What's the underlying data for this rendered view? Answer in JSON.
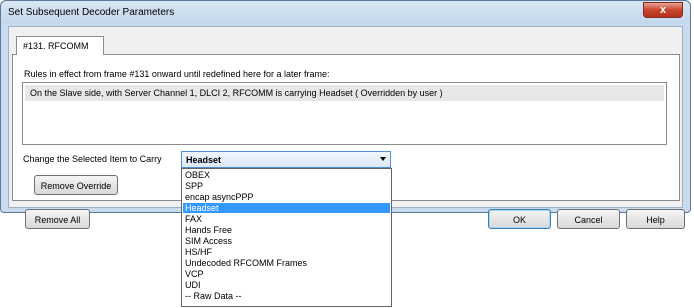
{
  "dialog": {
    "title": "Set Subsequent Decoder Parameters",
    "close_glyph": "x"
  },
  "tab": {
    "label": "#131. RFCOMM"
  },
  "rules": {
    "label": "Rules in effect from frame #131 onward until redefined here for a later frame:",
    "rows": [
      "On the Slave side, with Server Channel 1, DLCI 2, RFCOMM is carrying Headset ( Overridden by user )"
    ]
  },
  "change": {
    "label": "Change the Selected Item to Carry",
    "selected": "Headset"
  },
  "dropdown": {
    "options": [
      "OBEX",
      "SPP",
      "encap asyncPPP",
      "Headset",
      "FAX",
      "Hands Free",
      "SIM Access",
      "HS/HF",
      "Undecoded RFCOMM Frames",
      "VCP",
      "UDI",
      "-- Raw Data --"
    ],
    "selected_index": 3
  },
  "buttons": {
    "remove_override": "Remove Override",
    "remove_all": "Remove All",
    "ok": "OK",
    "cancel": "Cancel",
    "help": "Help"
  },
  "colors": {
    "highlight": "#3399ff",
    "frame": "#c9dbee"
  }
}
